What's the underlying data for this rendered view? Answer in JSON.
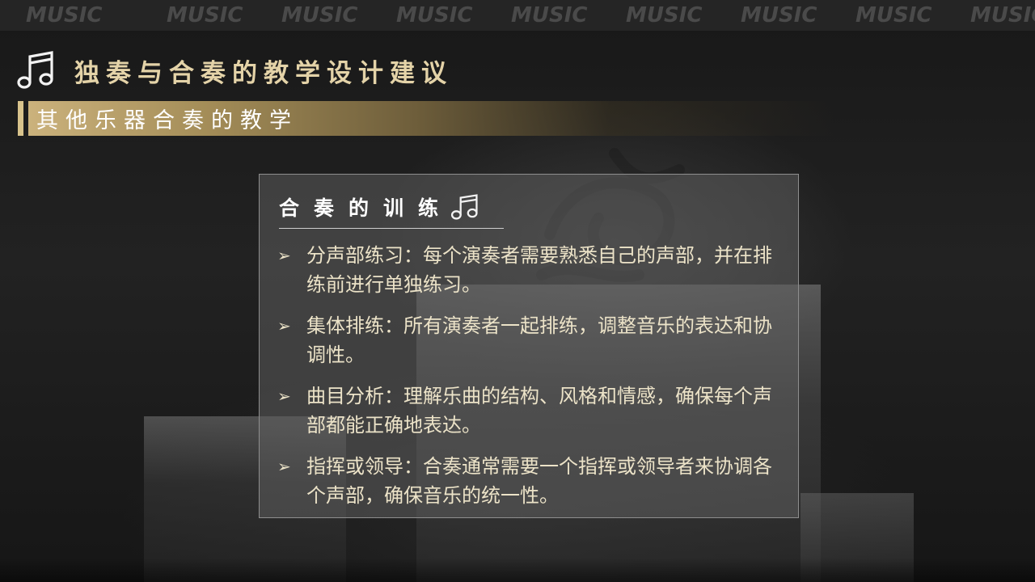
{
  "banner": {
    "words": [
      "MUSIC",
      "MUSIC",
      "MUSIC",
      "MUSIC",
      "MUSIC",
      "MUSIC",
      "MUSIC",
      "MUSIC",
      "MUSIC"
    ]
  },
  "header": {
    "icon": "music-note-icon",
    "title": "独奏与合奏的教学设计建议"
  },
  "subheader": {
    "title": "其他乐器合奏的教学"
  },
  "card": {
    "title": "合奏的训练",
    "icon": "music-note-icon",
    "bullet_glyph": "➢",
    "items": [
      {
        "text": "分声部练习：每个演奏者需要熟悉自己的声部，并在排练前进行单独练习。"
      },
      {
        "text": "集体排练：所有演奏者一起排练，调整音乐的表达和协调性。"
      },
      {
        "text": "曲目分析：理解乐曲的结构、风格和情感，确保每个声部都能正确地表达。"
      },
      {
        "text": "指挥或领导：合奏通常需要一个指挥或领导者来协调各个声部，确保音乐的统一性。"
      }
    ]
  },
  "colors": {
    "gold_text": "#e4d3a8",
    "gold_bar": "#cbb27c",
    "body_text": "#ece3c8",
    "background": "#1c1c1c"
  }
}
